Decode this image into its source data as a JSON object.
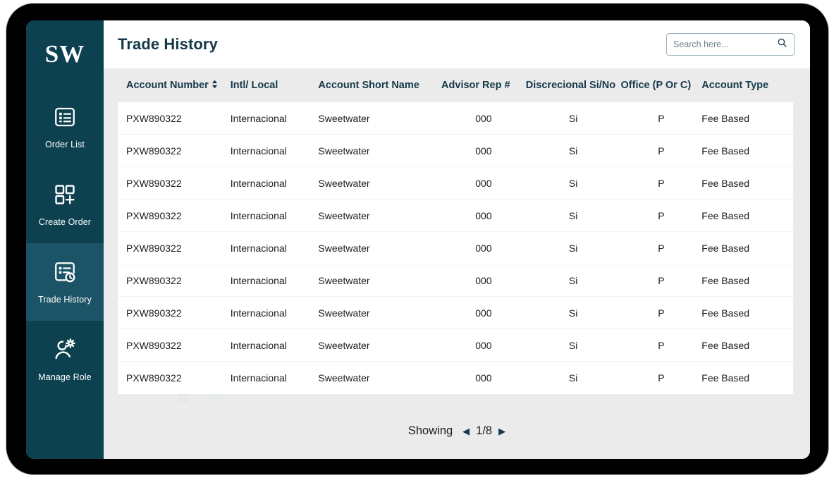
{
  "brand": {
    "logo_text": "SW"
  },
  "sidebar": {
    "items": [
      {
        "label": "Order List",
        "icon": "list-document-icon",
        "active": false
      },
      {
        "label": "Create Order",
        "icon": "grid-plus-icon",
        "active": false
      },
      {
        "label": "Trade History",
        "icon": "document-clock-icon",
        "active": true
      },
      {
        "label": "Manage Role",
        "icon": "user-gear-icon",
        "active": false
      }
    ]
  },
  "header": {
    "title": "Trade History"
  },
  "search": {
    "placeholder": "Search here...",
    "value": "",
    "icon": "search-icon"
  },
  "table": {
    "columns": [
      {
        "label": "Account Number",
        "sortable": true,
        "key": "account_number"
      },
      {
        "label": "Intl/ Local",
        "sortable": false,
        "key": "intl_local"
      },
      {
        "label": "Account Short Name",
        "sortable": false,
        "key": "account_short_name"
      },
      {
        "label": "Advisor Rep #",
        "sortable": false,
        "key": "advisor_rep"
      },
      {
        "label": "Discrecional Si/No",
        "sortable": false,
        "key": "discrecional"
      },
      {
        "label": "Office (P Or C)",
        "sortable": false,
        "key": "office"
      },
      {
        "label": "Account Type",
        "sortable": false,
        "key": "account_type"
      }
    ],
    "rows": [
      {
        "account_number": "PXW890322",
        "intl_local": "Internacional",
        "account_short_name": "Sweetwater",
        "advisor_rep": "000",
        "discrecional": "Si",
        "office": "P",
        "account_type": "Fee Based"
      },
      {
        "account_number": "PXW890322",
        "intl_local": "Internacional",
        "account_short_name": "Sweetwater",
        "advisor_rep": "000",
        "discrecional": "Si",
        "office": "P",
        "account_type": "Fee Based"
      },
      {
        "account_number": "PXW890322",
        "intl_local": "Internacional",
        "account_short_name": "Sweetwater",
        "advisor_rep": "000",
        "discrecional": "Si",
        "office": "P",
        "account_type": "Fee Based"
      },
      {
        "account_number": "PXW890322",
        "intl_local": "Internacional",
        "account_short_name": "Sweetwater",
        "advisor_rep": "000",
        "discrecional": "Si",
        "office": "P",
        "account_type": "Fee Based"
      },
      {
        "account_number": "PXW890322",
        "intl_local": "Internacional",
        "account_short_name": "Sweetwater",
        "advisor_rep": "000",
        "discrecional": "Si",
        "office": "P",
        "account_type": "Fee Based"
      },
      {
        "account_number": "PXW890322",
        "intl_local": "Internacional",
        "account_short_name": "Sweetwater",
        "advisor_rep": "000",
        "discrecional": "Si",
        "office": "P",
        "account_type": "Fee Based"
      },
      {
        "account_number": "PXW890322",
        "intl_local": "Internacional",
        "account_short_name": "Sweetwater",
        "advisor_rep": "000",
        "discrecional": "Si",
        "office": "P",
        "account_type": "Fee Based"
      },
      {
        "account_number": "PXW890322",
        "intl_local": "Internacional",
        "account_short_name": "Sweetwater",
        "advisor_rep": "000",
        "discrecional": "Si",
        "office": "P",
        "account_type": "Fee Based"
      },
      {
        "account_number": "PXW890322",
        "intl_local": "Internacional",
        "account_short_name": "Sweetwater",
        "advisor_rep": "000",
        "discrecional": "Si",
        "office": "P",
        "account_type": "Fee Based"
      }
    ]
  },
  "pagination": {
    "showing_label": "Showing",
    "page_indicator": "1/8",
    "current_page": 1,
    "total_pages": 8,
    "prev_glyph": "◀",
    "next_glyph": "▶"
  },
  "watermark": {
    "icon": "lightbulb-arc-watermark"
  },
  "colors": {
    "sidebar_bg": "#0d4150",
    "sidebar_active_bg": "#1c5467",
    "page_bg": "#ebebeb",
    "surface": "#ffffff",
    "heading": "#15394a",
    "bezel": "#000000"
  }
}
